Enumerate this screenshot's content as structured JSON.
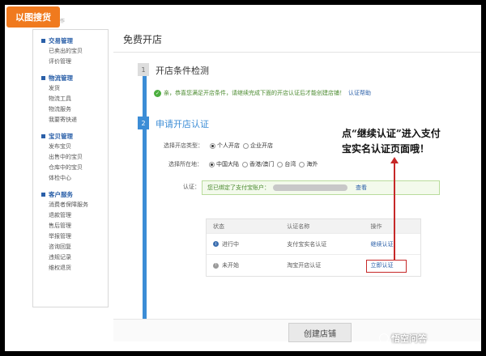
{
  "badge": {
    "label": "以图搜货",
    "ghost": "作"
  },
  "sidebar": {
    "sections": [
      {
        "title": "交易管理",
        "items": [
          "已卖出的宝贝",
          "评价管理"
        ]
      },
      {
        "title": "物流管理",
        "items": [
          "发货",
          "物流工具",
          "物流服务",
          "我要寄快递"
        ]
      },
      {
        "title": "宝贝管理",
        "items": [
          "发布宝贝",
          "出售中的宝贝",
          "仓库中的宝贝",
          "体检中心"
        ]
      },
      {
        "title": "客户服务",
        "items": [
          "消费者保障服务",
          "退款管理",
          "售后管理",
          "举报管理",
          "咨询回复",
          "违规记录",
          "维权退货"
        ]
      }
    ]
  },
  "main": {
    "title": "免费开店",
    "step1": {
      "num": "1",
      "title": "开店条件检测",
      "check_text": "亲，恭喜您满足开店条件，请继续完成下面的开店认证后才能创建店铺！",
      "check_link": "认证帮助"
    },
    "step2": {
      "num": "2",
      "title": "申请开店认证"
    },
    "form": {
      "type_label": "选择开店类型：",
      "type_options": [
        "个人开店",
        "企业开店"
      ],
      "region_label": "选择所在地：",
      "region_options": [
        "中国大陆",
        "香港/澳门",
        "台湾",
        "海外"
      ],
      "auth_label": "认证：",
      "auth_text": "您已绑定了支付宝账户：",
      "auth_link": "查看"
    },
    "table": {
      "headers": [
        "状态",
        "认证名称",
        "操作"
      ],
      "rows": [
        {
          "status_icon": "i",
          "status": "进行中",
          "name": "支付宝实名认证",
          "action": "继续认证"
        },
        {
          "status_icon": "!",
          "status": "未开始",
          "name": "淘宝开店认证",
          "action": "立即认证"
        }
      ]
    },
    "create_button": "创建店铺"
  },
  "annotation": {
    "line1": "点“继续认证”进入支付",
    "line2": "宝实名认证页面哦！"
  },
  "watermark": "悟空问答",
  "colors": {
    "accent": "#3c8dd6",
    "badge": "#f07a1e",
    "highlight": "#c62828",
    "success": "#4caf3f"
  }
}
